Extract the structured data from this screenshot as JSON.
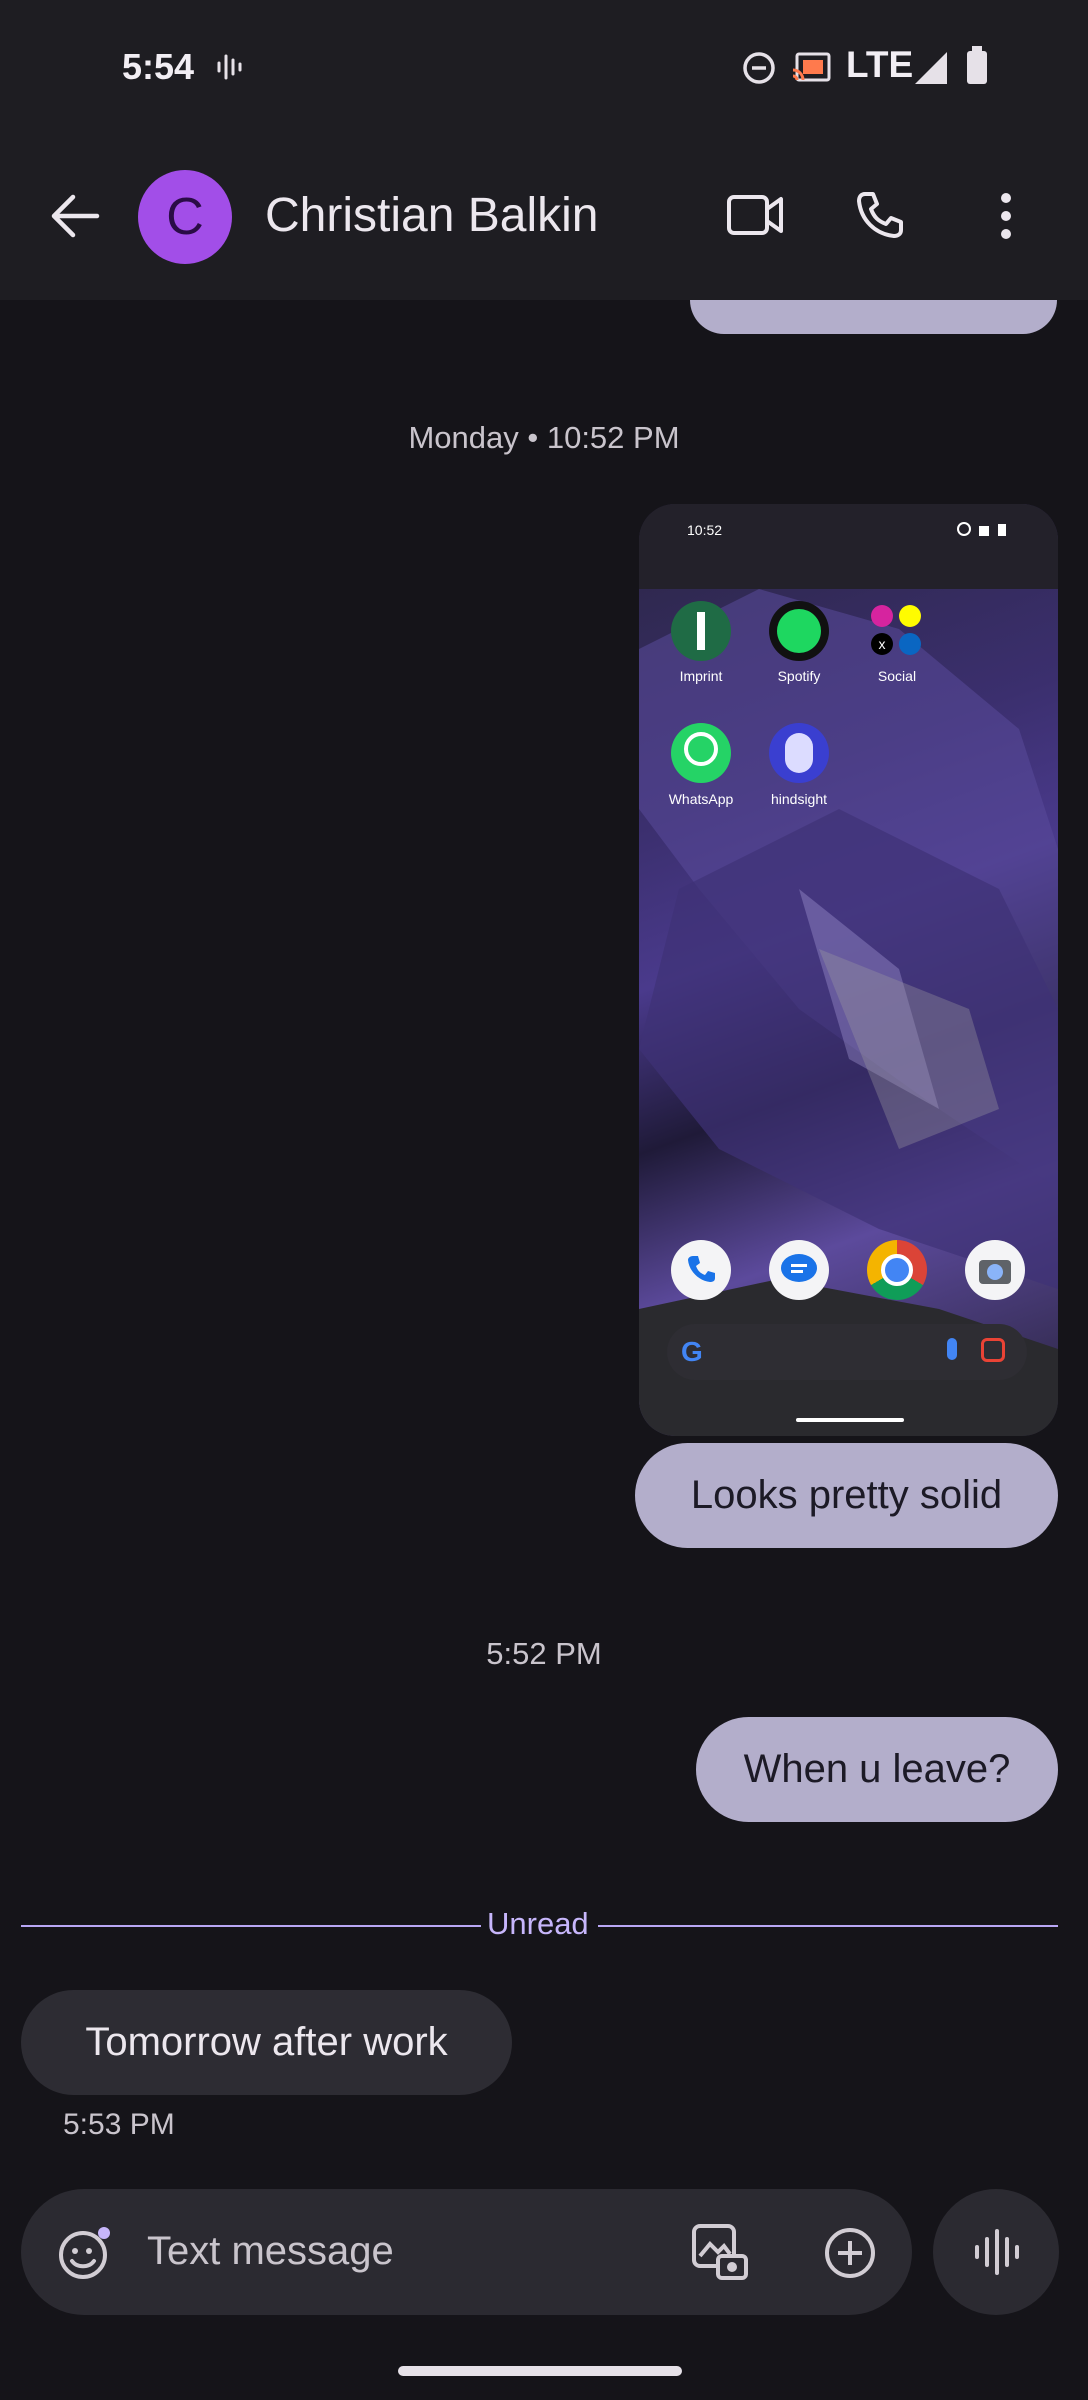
{
  "status_bar": {
    "time": "5:54",
    "network": "LTE",
    "icons": [
      "voice-activity-icon",
      "do-not-disturb-icon",
      "cast-icon",
      "signal-icon",
      "battery-icon"
    ]
  },
  "header": {
    "avatar_initial": "C",
    "contact_name": "Christian Balkin",
    "actions": [
      "back-arrow-icon",
      "video-call-icon",
      "phone-call-icon",
      "more-options-icon"
    ]
  },
  "messages": {
    "date_separator_1": "Monday • 10:52 PM",
    "shared_screenshot": {
      "status_time": "10:52",
      "apps": [
        {
          "label": "Imprint",
          "icon": "imprint-app-icon"
        },
        {
          "label": "Spotify",
          "icon": "spotify-app-icon"
        },
        {
          "label": "Social",
          "icon": "social-folder-icon"
        },
        {
          "label": "WhatsApp",
          "icon": "whatsapp-app-icon"
        },
        {
          "label": "hindsight",
          "icon": "hindsight-app-icon"
        }
      ],
      "dock": [
        "phone-app-icon",
        "messages-app-icon",
        "chrome-app-icon",
        "camera-app-icon"
      ]
    },
    "outgoing_1": "Looks pretty solid",
    "time_separator_2": "5:52 PM",
    "outgoing_2": "When u leave?",
    "unread_label": "Unread",
    "incoming_1": "Tomorrow after work",
    "incoming_1_time": "5:53 PM"
  },
  "composer": {
    "placeholder": "Text message",
    "icons": [
      "emoji-icon",
      "gallery-icon",
      "add-icon",
      "voice-input-icon"
    ]
  },
  "colors": {
    "background": "#151419",
    "bar": "#1e1d22",
    "avatar": "#a24ee8",
    "outgoing_bubble": "#b3aecb",
    "incoming_bubble": "#2d2c33",
    "unread_line": "#b9a7f5"
  }
}
